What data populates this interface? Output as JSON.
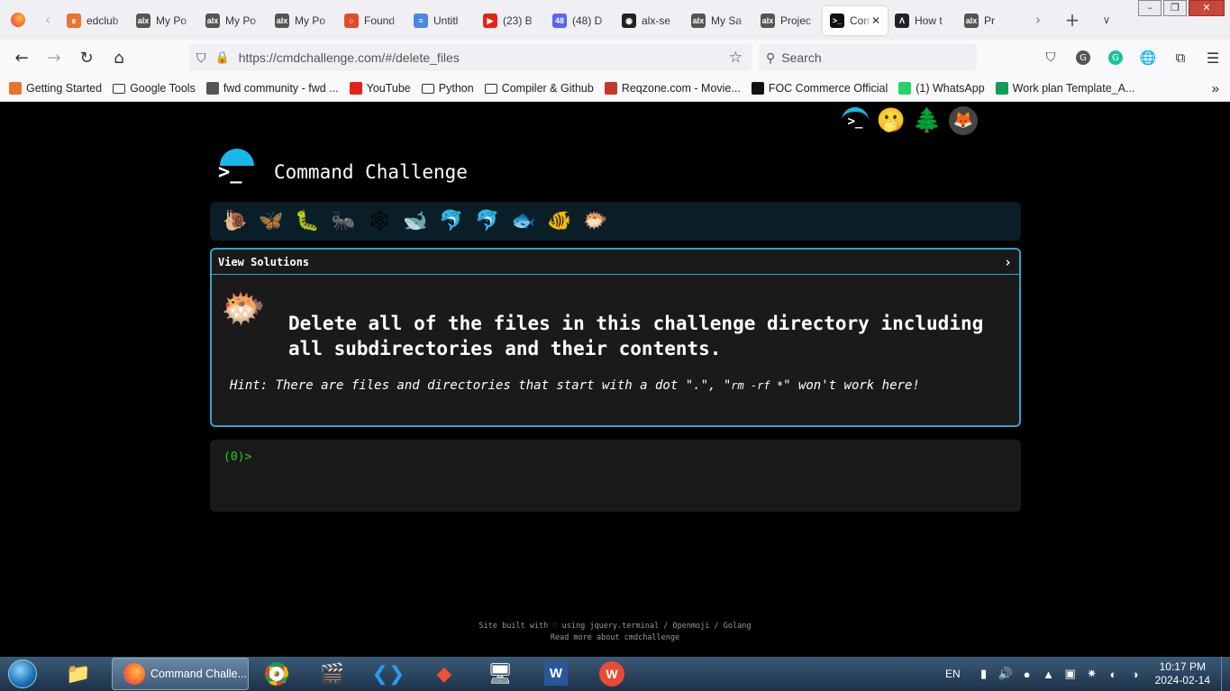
{
  "browser": {
    "tabs": [
      {
        "label": "edclub",
        "color": "#e8742f",
        "glyph": "e"
      },
      {
        "label": "My Po",
        "color": "#555",
        "glyph": "alx"
      },
      {
        "label": "My Po",
        "color": "#555",
        "glyph": "alx"
      },
      {
        "label": "My Po",
        "color": "#555",
        "glyph": "alx"
      },
      {
        "label": "Found",
        "color": "#e04c2e",
        "glyph": "○"
      },
      {
        "label": "Untitl",
        "color": "#4a86e8",
        "glyph": "≡"
      },
      {
        "label": "(23) B",
        "color": "#e62117",
        "glyph": "▶"
      },
      {
        "label": "(48) D",
        "color": "#5865f2",
        "glyph": "48"
      },
      {
        "label": "alx-se",
        "color": "#222",
        "glyph": "◉"
      },
      {
        "label": "My Sa",
        "color": "#555",
        "glyph": "alx"
      },
      {
        "label": "Projec",
        "color": "#555",
        "glyph": "alx"
      },
      {
        "label": "Com",
        "color": "#111",
        "glyph": ">_",
        "active": true
      },
      {
        "label": "How t",
        "color": "#222",
        "glyph": "Λ"
      },
      {
        "label": "Pr",
        "color": "#555",
        "glyph": "alx"
      }
    ],
    "url": "https://cmdchallenge.com/#/delete_files",
    "search_placeholder": "Search",
    "bookmarks": [
      {
        "label": "Getting Started",
        "color": "#e8742f"
      },
      {
        "label": "Google Tools",
        "color": "folder"
      },
      {
        "label": "fwd community - fwd ...",
        "color": "#555"
      },
      {
        "label": "YouTube",
        "color": "#e62117"
      },
      {
        "label": "Python",
        "color": "folder"
      },
      {
        "label": "Compiler & Github",
        "color": "folder"
      },
      {
        "label": "Reqzone.com - Movie...",
        "color": "#c0392b"
      },
      {
        "label": "FOC Commerce Official",
        "color": "#111"
      },
      {
        "label": "(1) WhatsApp",
        "color": "#25d366"
      },
      {
        "label": "Work plan Template_A...",
        "color": "#0f9d58"
      }
    ]
  },
  "site": {
    "title": "Command Challenge",
    "top_icons": [
      "terminal-icon",
      "hushed-face-icon",
      "evergreen-tree-icon",
      "gitlab-icon",
      "envelope-icon"
    ],
    "levels": [
      "🐌",
      "🦋",
      "🐛",
      "🐜",
      "🕸",
      "🐋",
      "🐬",
      "🐬",
      "🐟",
      "🐠",
      "🐡"
    ],
    "challenge": {
      "view_solutions": "View Solutions",
      "level_icon": "🐡",
      "task": "Delete all of the files in this challenge directory including all subdirectories and their contents.",
      "hint_prefix": "Hint: There are files and directories that start with a dot \".\", \"",
      "hint_cmd": "rm -rf *",
      "hint_suffix": "\" won't work here!"
    },
    "terminal_prompt": "(0)>",
    "footer_line1": "Site built with ♡ using jquery.terminal / Openmoji / Golang",
    "footer_line2": "Read more about cmdchallenge"
  },
  "taskbar": {
    "active_app": "Command Challe...",
    "lang": "EN",
    "time": "10:17 PM",
    "date": "2024-02-14"
  }
}
